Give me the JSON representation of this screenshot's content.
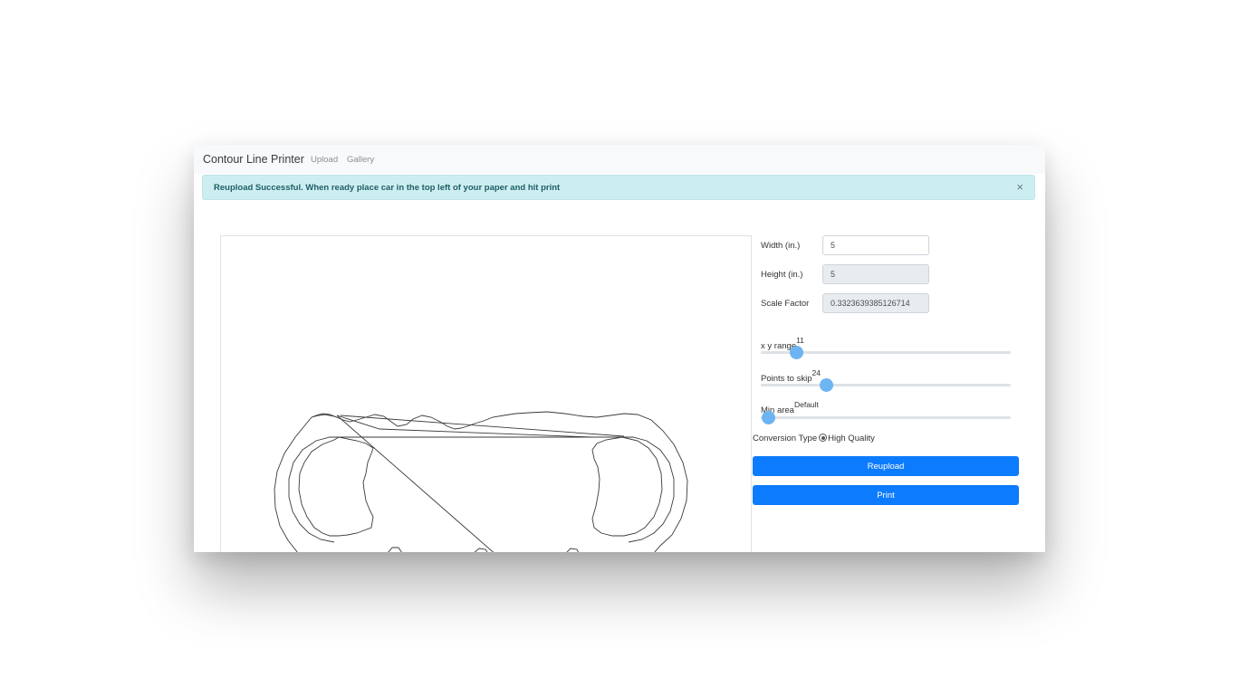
{
  "navbar": {
    "brand": "Contour Line Printer",
    "links": [
      "Upload",
      "Gallery"
    ]
  },
  "alert": {
    "message": "Reupload Successful. When ready place car in the top left of your paper and hit print",
    "close_glyph": "×"
  },
  "form": {
    "width": {
      "label": "Width (in.)",
      "value": "5"
    },
    "height": {
      "label": "Height (in.)",
      "value": "5"
    },
    "scale": {
      "label": "Scale Factor",
      "value": "0.3323639385126714"
    }
  },
  "sliders": [
    {
      "label": "x y range",
      "value_text": "11",
      "position_fraction": 0.14
    },
    {
      "label": "Points to skip",
      "value_text": "24",
      "position_fraction": 0.26
    },
    {
      "label": "Min area",
      "value_text": "Default",
      "position_fraction": 0.03
    }
  ],
  "conversion": {
    "label": "Conversion Type",
    "option": "High Quality"
  },
  "buttons": {
    "reupload": "Reupload",
    "print": "Print"
  },
  "colors": {
    "primary": "#0d7bfd",
    "slider_thumb": "#6db4f2",
    "alert_bg": "#cdeef1",
    "alert_text": "#1e5d66"
  },
  "icons": {
    "close": "close-icon",
    "radio": "radio-selected-icon"
  }
}
